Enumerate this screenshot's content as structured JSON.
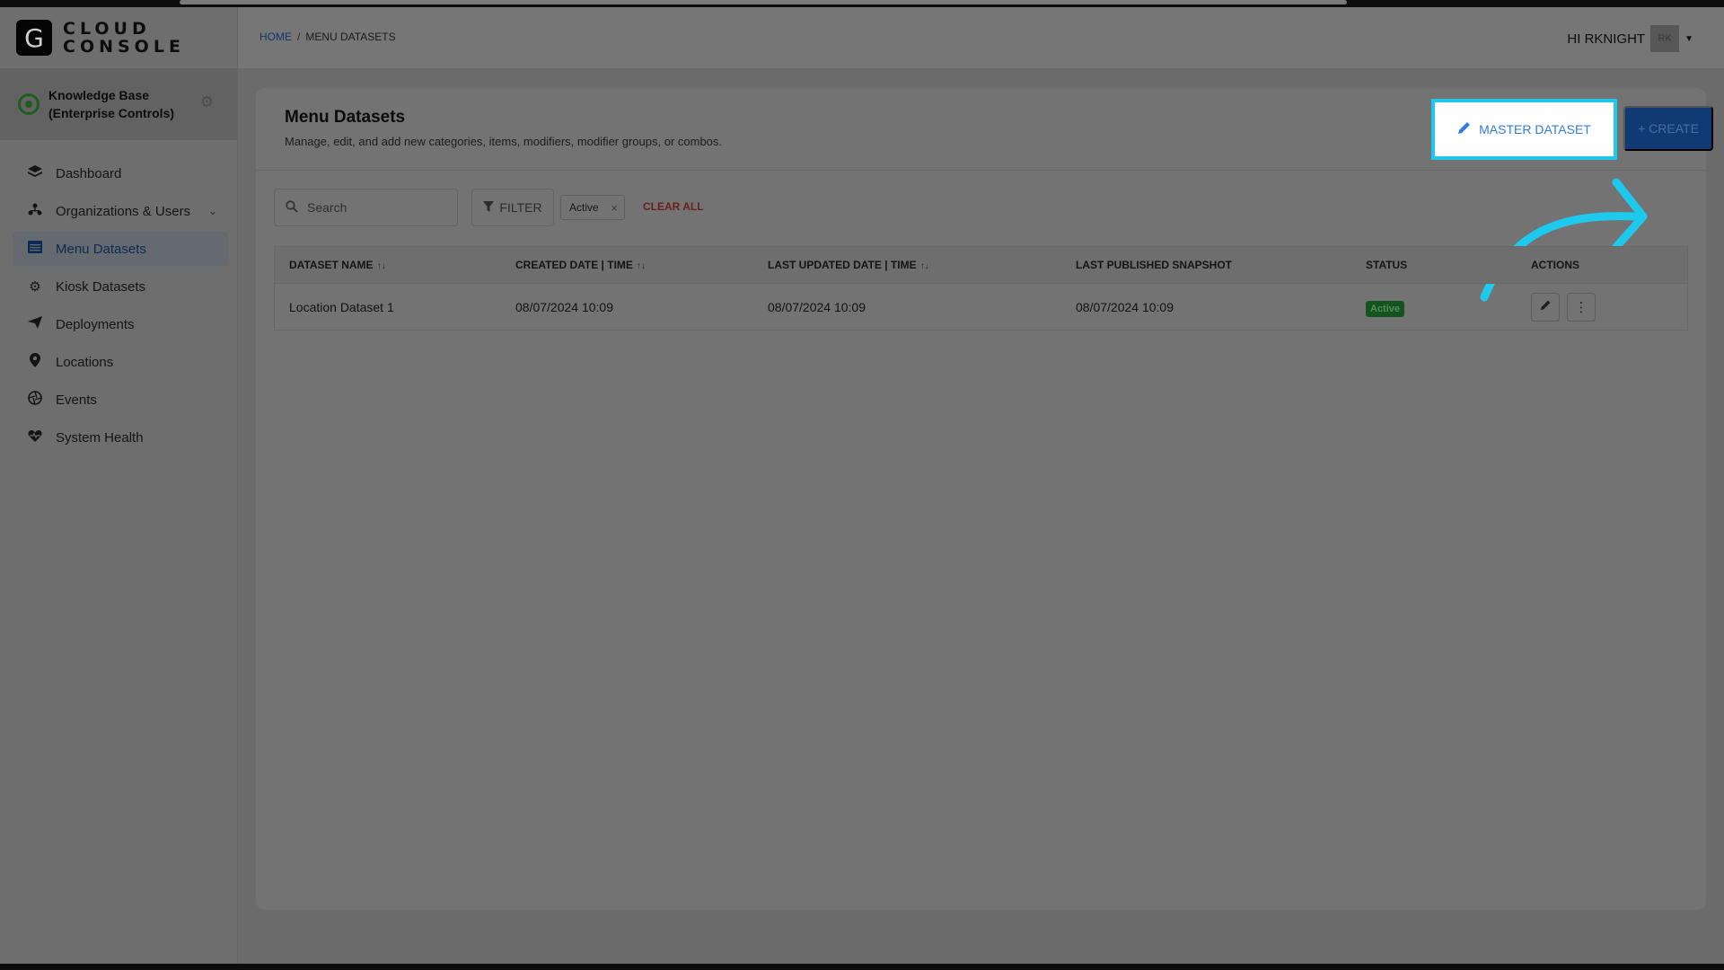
{
  "app": {
    "logo_letter": "G",
    "logo_line1": "CLOUD",
    "logo_line2": "CONSOLE"
  },
  "org": {
    "name_line1": "Knowledge Base",
    "name_line2": "(Enterprise Controls)"
  },
  "sidebar": {
    "items": [
      {
        "label": "Dashboard",
        "icon": "layers-icon"
      },
      {
        "label": "Organizations & Users",
        "icon": "org-chart-icon"
      },
      {
        "label": "Menu Datasets",
        "icon": "menu-table-icon"
      },
      {
        "label": "Kiosk Datasets",
        "icon": "gear-icon"
      },
      {
        "label": "Deployments",
        "icon": "send-icon"
      },
      {
        "label": "Locations",
        "icon": "map-pin-icon"
      },
      {
        "label": "Events",
        "icon": "aperture-icon"
      },
      {
        "label": "System Health",
        "icon": "heartbeat-icon"
      }
    ],
    "active": "Menu Datasets"
  },
  "header": {
    "breadcrumb_home": "HOME",
    "breadcrumb_sep": "/",
    "breadcrumb_current": "MENU DATASETS",
    "greeting": "HI RKNIGHT",
    "avatar_initials": "RK"
  },
  "page": {
    "title": "Menu Datasets",
    "subtitle": "Manage, edit, and add new categories, items, modifiers, modifier groups, or combos.",
    "master_button": "MASTER DATASET",
    "create_button": "+ CREATE"
  },
  "toolbar": {
    "search_placeholder": "Search",
    "filter_label": "FILTER",
    "chip_label": "Active",
    "clear_all": "CLEAR ALL"
  },
  "table": {
    "headers": [
      "DATASET NAME",
      "CREATED DATE | TIME",
      "LAST UPDATED DATE | TIME",
      "LAST PUBLISHED SNAPSHOT",
      "STATUS",
      "ACTIONS"
    ],
    "rows": [
      {
        "name": "Location Dataset 1",
        "created": "08/07/2024 10:09",
        "updated": "08/07/2024 10:09",
        "published": "08/07/2024 10:09",
        "status": "Active"
      }
    ]
  },
  "colors": {
    "highlight": "#1ec9ee",
    "primary": "#2e7de0",
    "status_active": "#14521f",
    "clear_all": "#6b1e1e"
  }
}
